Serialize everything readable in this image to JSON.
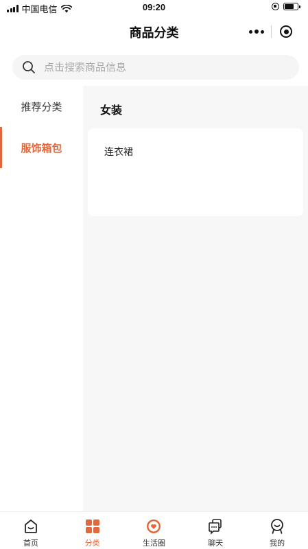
{
  "status_bar": {
    "carrier": "中国电信",
    "time": "09:20"
  },
  "nav": {
    "title": "商品分类"
  },
  "search": {
    "placeholder": "点击搜索商品信息"
  },
  "sidebar": {
    "items": [
      {
        "label": "推荐分类",
        "active": false
      },
      {
        "label": "服饰箱包",
        "active": true
      }
    ]
  },
  "content": {
    "section_title": "女装",
    "items": [
      {
        "label": "连衣裙"
      }
    ]
  },
  "tabbar": {
    "tabs": [
      {
        "label": "首页",
        "icon": "home-icon"
      },
      {
        "label": "分类",
        "icon": "category-icon",
        "active": true
      },
      {
        "label": "生活圈",
        "icon": "heart-bubble-icon"
      },
      {
        "label": "聊天",
        "icon": "chat-icon"
      },
      {
        "label": "我的",
        "icon": "profile-icon"
      }
    ]
  },
  "colors": {
    "accent": "#e0683d",
    "content_bg": "#f7f7f7"
  }
}
